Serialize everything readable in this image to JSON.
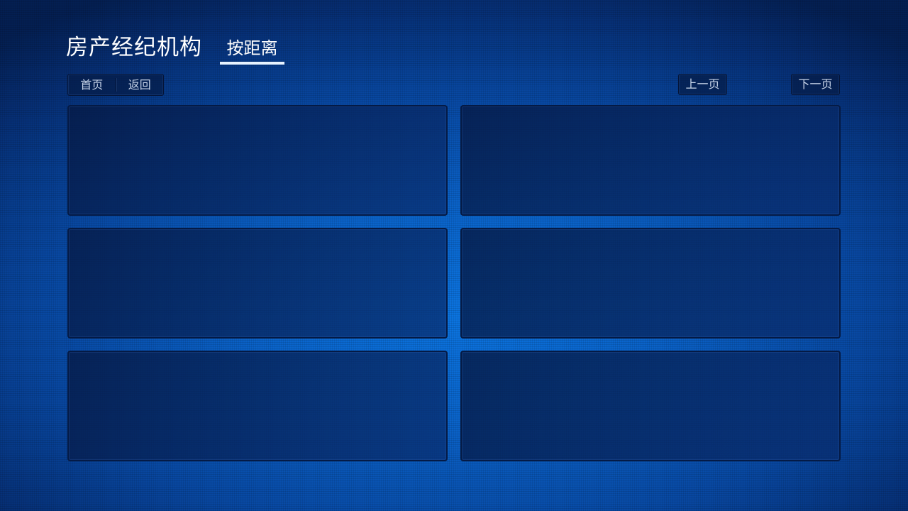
{
  "header": {
    "title": "房产经纪机构",
    "active_tab": "按距离"
  },
  "toolbar": {
    "home_label": "首页",
    "back_label": "返回",
    "prev_label": "上一页",
    "next_label": "下一页"
  },
  "cards": [
    {
      "slot": 1
    },
    {
      "slot": 2
    },
    {
      "slot": 3
    },
    {
      "slot": 4
    },
    {
      "slot": 5
    },
    {
      "slot": 6
    }
  ],
  "colors": {
    "accent": "#e8f3ff",
    "background_center": "#0b74e0",
    "background_edge": "#041f52",
    "panel": "#072a6a"
  }
}
